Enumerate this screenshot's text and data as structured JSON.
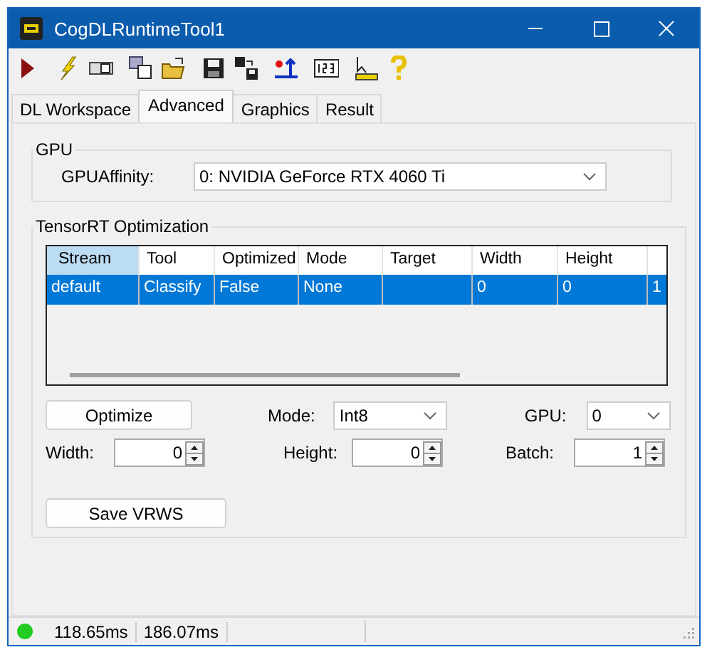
{
  "window": {
    "title": "CogDLRuntimeTool1"
  },
  "toolbar": [
    {
      "kind": "play"
    },
    {
      "kind": "lightning"
    },
    {
      "kind": "dialog"
    },
    {
      "kind": "dialogs"
    },
    {
      "kind": "open"
    },
    {
      "kind": "save"
    },
    {
      "kind": "saveall"
    },
    {
      "kind": "import"
    },
    {
      "kind": "numbers"
    },
    {
      "kind": "measure"
    },
    {
      "kind": "help"
    }
  ],
  "tabs": [
    {
      "label": "DL Workspace",
      "selected": false
    },
    {
      "label": "Advanced",
      "selected": true
    },
    {
      "label": "Graphics",
      "selected": false
    },
    {
      "label": "Result",
      "selected": false
    }
  ],
  "gpu_group": {
    "title": "GPU",
    "affinity_label": "GPUAffinity:",
    "affinity_value": "0: NVIDIA GeForce RTX 4060 Ti"
  },
  "tensorrt_group": {
    "title": "TensorRT Optimization",
    "table": {
      "columns": [
        "Stream",
        "Tool",
        "Optimized",
        "Mode",
        "Target",
        "Width",
        "Height"
      ],
      "rows": [
        {
          "selected": true,
          "cells": [
            "default",
            "Classify",
            "False",
            "None",
            "",
            "0",
            "0",
            "1"
          ]
        }
      ]
    },
    "optimize_button": "Optimize",
    "mode_label": "Mode:",
    "mode_value": "Int8",
    "gpu_label": "GPU:",
    "gpu_value": "0",
    "width_label": "Width:",
    "width_value": "0",
    "height_label": "Height:",
    "height_value": "0",
    "batch_label": "Batch:",
    "batch_value": "1",
    "save_button": "Save VRWS"
  },
  "status_bar": {
    "indicator": {
      "color": "#22cc22"
    },
    "times": [
      "118.65ms",
      "186.07ms"
    ]
  }
}
